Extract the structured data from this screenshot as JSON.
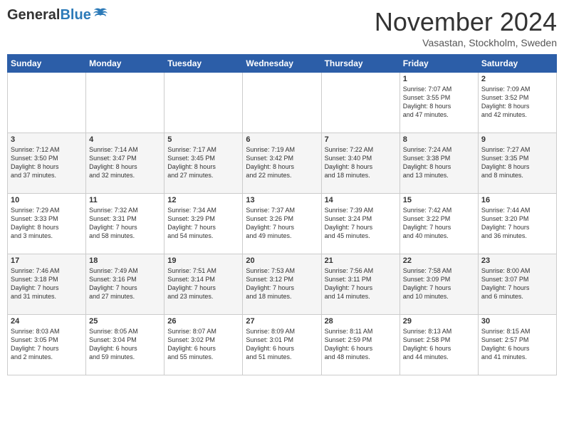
{
  "header": {
    "logo_general": "General",
    "logo_blue": "Blue",
    "month_title": "November 2024",
    "location": "Vasastan, Stockholm, Sweden"
  },
  "days_of_week": [
    "Sunday",
    "Monday",
    "Tuesday",
    "Wednesday",
    "Thursday",
    "Friday",
    "Saturday"
  ],
  "weeks": [
    [
      {
        "day": "",
        "info": ""
      },
      {
        "day": "",
        "info": ""
      },
      {
        "day": "",
        "info": ""
      },
      {
        "day": "",
        "info": ""
      },
      {
        "day": "",
        "info": ""
      },
      {
        "day": "1",
        "info": "Sunrise: 7:07 AM\nSunset: 3:55 PM\nDaylight: 8 hours\nand 47 minutes."
      },
      {
        "day": "2",
        "info": "Sunrise: 7:09 AM\nSunset: 3:52 PM\nDaylight: 8 hours\nand 42 minutes."
      }
    ],
    [
      {
        "day": "3",
        "info": "Sunrise: 7:12 AM\nSunset: 3:50 PM\nDaylight: 8 hours\nand 37 minutes."
      },
      {
        "day": "4",
        "info": "Sunrise: 7:14 AM\nSunset: 3:47 PM\nDaylight: 8 hours\nand 32 minutes."
      },
      {
        "day": "5",
        "info": "Sunrise: 7:17 AM\nSunset: 3:45 PM\nDaylight: 8 hours\nand 27 minutes."
      },
      {
        "day": "6",
        "info": "Sunrise: 7:19 AM\nSunset: 3:42 PM\nDaylight: 8 hours\nand 22 minutes."
      },
      {
        "day": "7",
        "info": "Sunrise: 7:22 AM\nSunset: 3:40 PM\nDaylight: 8 hours\nand 18 minutes."
      },
      {
        "day": "8",
        "info": "Sunrise: 7:24 AM\nSunset: 3:38 PM\nDaylight: 8 hours\nand 13 minutes."
      },
      {
        "day": "9",
        "info": "Sunrise: 7:27 AM\nSunset: 3:35 PM\nDaylight: 8 hours\nand 8 minutes."
      }
    ],
    [
      {
        "day": "10",
        "info": "Sunrise: 7:29 AM\nSunset: 3:33 PM\nDaylight: 8 hours\nand 3 minutes."
      },
      {
        "day": "11",
        "info": "Sunrise: 7:32 AM\nSunset: 3:31 PM\nDaylight: 7 hours\nand 58 minutes."
      },
      {
        "day": "12",
        "info": "Sunrise: 7:34 AM\nSunset: 3:29 PM\nDaylight: 7 hours\nand 54 minutes."
      },
      {
        "day": "13",
        "info": "Sunrise: 7:37 AM\nSunset: 3:26 PM\nDaylight: 7 hours\nand 49 minutes."
      },
      {
        "day": "14",
        "info": "Sunrise: 7:39 AM\nSunset: 3:24 PM\nDaylight: 7 hours\nand 45 minutes."
      },
      {
        "day": "15",
        "info": "Sunrise: 7:42 AM\nSunset: 3:22 PM\nDaylight: 7 hours\nand 40 minutes."
      },
      {
        "day": "16",
        "info": "Sunrise: 7:44 AM\nSunset: 3:20 PM\nDaylight: 7 hours\nand 36 minutes."
      }
    ],
    [
      {
        "day": "17",
        "info": "Sunrise: 7:46 AM\nSunset: 3:18 PM\nDaylight: 7 hours\nand 31 minutes."
      },
      {
        "day": "18",
        "info": "Sunrise: 7:49 AM\nSunset: 3:16 PM\nDaylight: 7 hours\nand 27 minutes."
      },
      {
        "day": "19",
        "info": "Sunrise: 7:51 AM\nSunset: 3:14 PM\nDaylight: 7 hours\nand 23 minutes."
      },
      {
        "day": "20",
        "info": "Sunrise: 7:53 AM\nSunset: 3:12 PM\nDaylight: 7 hours\nand 18 minutes."
      },
      {
        "day": "21",
        "info": "Sunrise: 7:56 AM\nSunset: 3:11 PM\nDaylight: 7 hours\nand 14 minutes."
      },
      {
        "day": "22",
        "info": "Sunrise: 7:58 AM\nSunset: 3:09 PM\nDaylight: 7 hours\nand 10 minutes."
      },
      {
        "day": "23",
        "info": "Sunrise: 8:00 AM\nSunset: 3:07 PM\nDaylight: 7 hours\nand 6 minutes."
      }
    ],
    [
      {
        "day": "24",
        "info": "Sunrise: 8:03 AM\nSunset: 3:05 PM\nDaylight: 7 hours\nand 2 minutes."
      },
      {
        "day": "25",
        "info": "Sunrise: 8:05 AM\nSunset: 3:04 PM\nDaylight: 6 hours\nand 59 minutes."
      },
      {
        "day": "26",
        "info": "Sunrise: 8:07 AM\nSunset: 3:02 PM\nDaylight: 6 hours\nand 55 minutes."
      },
      {
        "day": "27",
        "info": "Sunrise: 8:09 AM\nSunset: 3:01 PM\nDaylight: 6 hours\nand 51 minutes."
      },
      {
        "day": "28",
        "info": "Sunrise: 8:11 AM\nSunset: 2:59 PM\nDaylight: 6 hours\nand 48 minutes."
      },
      {
        "day": "29",
        "info": "Sunrise: 8:13 AM\nSunset: 2:58 PM\nDaylight: 6 hours\nand 44 minutes."
      },
      {
        "day": "30",
        "info": "Sunrise: 8:15 AM\nSunset: 2:57 PM\nDaylight: 6 hours\nand 41 minutes."
      }
    ]
  ]
}
